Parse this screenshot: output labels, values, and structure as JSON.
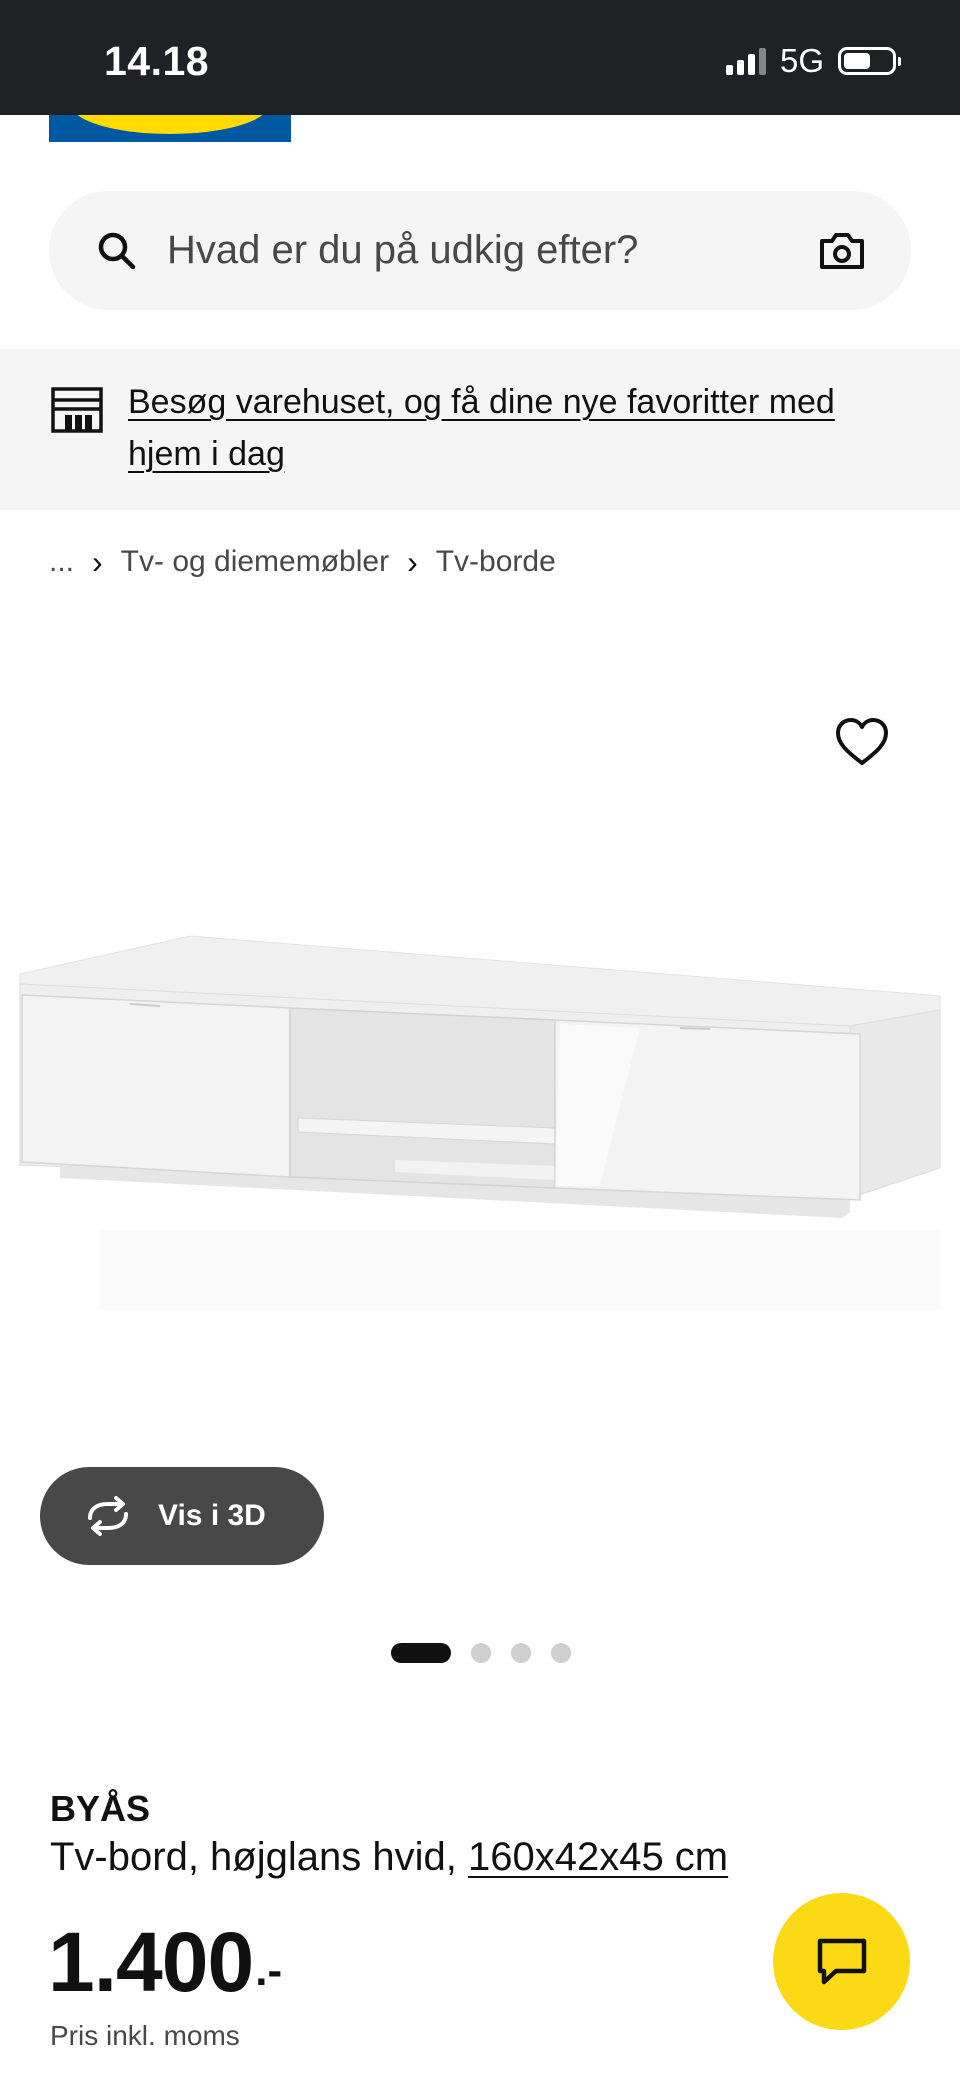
{
  "status_bar": {
    "time": "14.18",
    "network": "5G",
    "icons": [
      "signal-icon",
      "battery-icon"
    ]
  },
  "colors": {
    "brand_blue": "#0058a3",
    "brand_yellow": "#ffdb00",
    "chat_yellow": "#fbd914",
    "status_bar_bg": "#202124",
    "banner_bg": "#f5f5f5",
    "button_dark": "#484848"
  },
  "header": {
    "logo_icon": "ikea-logo"
  },
  "search": {
    "placeholder": "Hvad er du på udkig efter?",
    "search_icon": "search-icon",
    "camera_icon": "camera-icon"
  },
  "store_banner": {
    "icon": "store-icon",
    "link_text": "Besøg varehuset, og få dine nye favoritter med hjem i dag"
  },
  "breadcrumb": {
    "items": [
      "...",
      "Tv- og diememøbler",
      "Tv-borde"
    ]
  },
  "gallery": {
    "favorite_icon": "heart-icon",
    "view_3d_label": "Vis i 3D",
    "view_3d_icon": "rotate-3d-icon",
    "image_count": 4,
    "active_index": 0
  },
  "product": {
    "name": "BYÅS",
    "description": "Tv-bord, højglans hvid,",
    "dimensions": "160x42x45 cm",
    "price": "1.400",
    "price_suffix": ".-",
    "price_note": "Pris inkl. moms"
  },
  "chat": {
    "icon": "chat-icon"
  }
}
